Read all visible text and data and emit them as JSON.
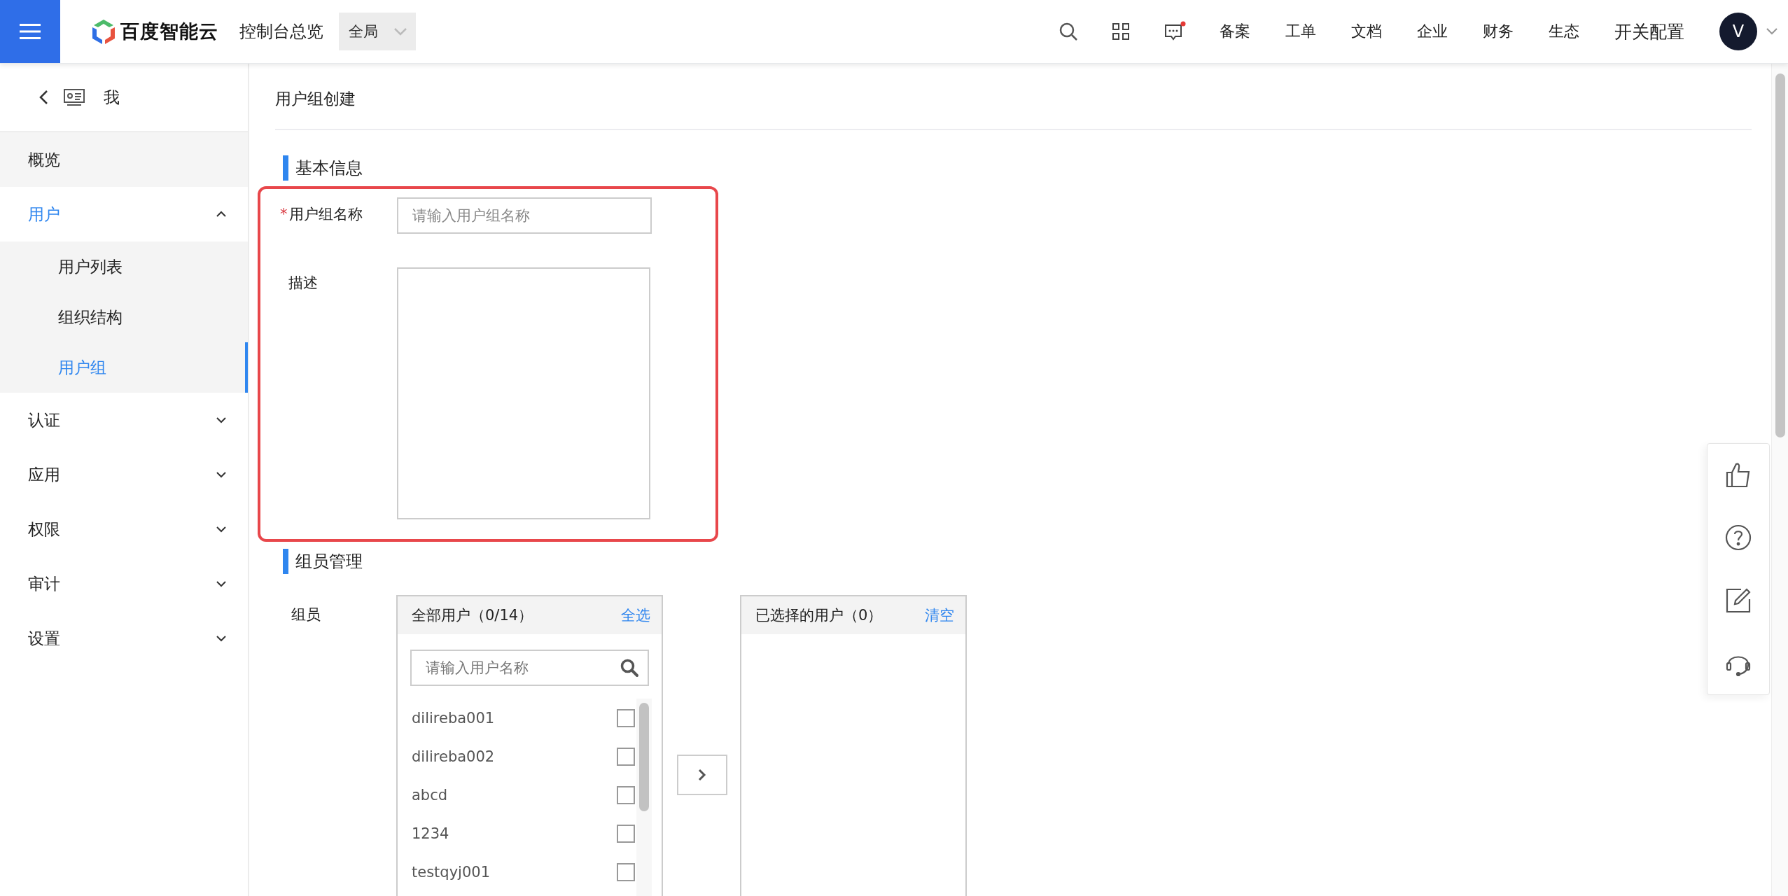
{
  "topbar": {
    "brand": "百度智能云",
    "console_link": "控制台总览",
    "region_select": "全局",
    "has_unread": true,
    "nav_items": [
      "备案",
      "工单",
      "文档",
      "企业",
      "财务",
      "生态",
      "开关配置"
    ],
    "avatar": "V"
  },
  "sidebar": {
    "header": "我",
    "items": [
      {
        "kind": "link",
        "label": "概览",
        "selected": false
      },
      {
        "kind": "group",
        "label": "用户",
        "selected": true,
        "expanded": true,
        "children": [
          {
            "label": "用户列表",
            "selected": false
          },
          {
            "label": "组织结构",
            "selected": false
          },
          {
            "label": "用户组",
            "selected": true
          }
        ]
      },
      {
        "kind": "group",
        "label": "认证",
        "selected": false,
        "expanded": false
      },
      {
        "kind": "group",
        "label": "应用",
        "selected": false,
        "expanded": false
      },
      {
        "kind": "group",
        "label": "权限",
        "selected": false,
        "expanded": false
      },
      {
        "kind": "group",
        "label": "审计",
        "selected": false,
        "expanded": false
      },
      {
        "kind": "group",
        "label": "设置",
        "selected": false,
        "expanded": false
      }
    ]
  },
  "page": {
    "title": "用户组创建",
    "basic_info": {
      "heading": "基本信息",
      "highlighted": true,
      "name_field": {
        "label": "用户组名称",
        "required_mark": "*",
        "placeholder": "请输入用户组名称"
      },
      "description_field": {
        "label": "描述"
      }
    },
    "members": {
      "heading": "组员管理",
      "label": "组员",
      "source": {
        "title": "全部用户（0/14）",
        "action": "全选",
        "search_placeholder": "请输入用户名称",
        "items": [
          {
            "name": "dilireba001",
            "checked": false
          },
          {
            "name": "dilireba002",
            "checked": false
          },
          {
            "name": "abcd",
            "checked": false
          },
          {
            "name": "1234",
            "checked": false
          },
          {
            "name": "testqyj001",
            "checked": false
          }
        ]
      },
      "target": {
        "title": "已选择的用户（0）",
        "action": "清空"
      }
    }
  }
}
